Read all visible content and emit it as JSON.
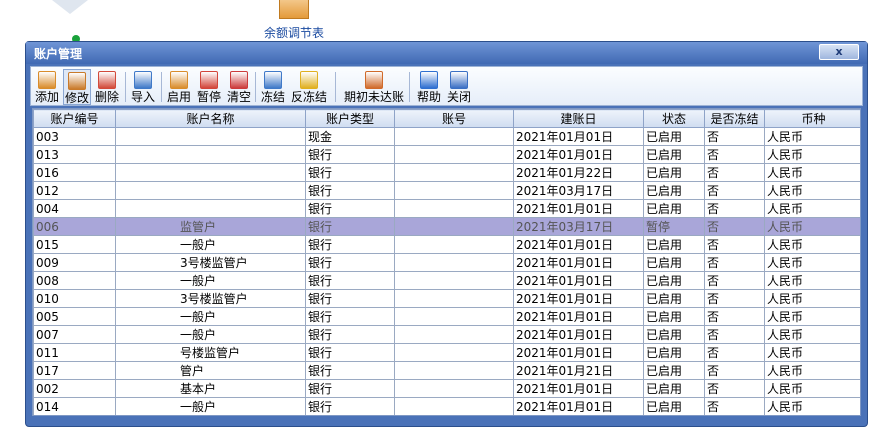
{
  "desktop": {
    "icon_label": "余额调节表"
  },
  "window": {
    "title": "账户管理",
    "close_symbol": "x"
  },
  "toolbar": [
    {
      "label": "添加",
      "icon": "add-icon",
      "color": "#d98c2b"
    },
    {
      "label": "修改",
      "icon": "edit-icon",
      "color": "#c97a2a"
    },
    {
      "label": "删除",
      "icon": "delete-icon",
      "color": "#d24a3a"
    },
    {
      "label": "导入",
      "icon": "import-icon",
      "color": "#3f79c8"
    },
    {
      "label": "启用",
      "icon": "enable-icon",
      "color": "#d98c2b"
    },
    {
      "label": "暂停",
      "icon": "pause-icon",
      "color": "#d2453a"
    },
    {
      "label": "清空",
      "icon": "clear-icon",
      "color": "#cc3b3b"
    },
    {
      "label": "冻结",
      "icon": "freeze-icon",
      "color": "#3f79c8"
    },
    {
      "label": "反冻结",
      "icon": "unfreeze-icon",
      "color": "#e0b020"
    },
    {
      "label": "期初未达账",
      "icon": "opening-icon",
      "color": "#d06a2a"
    },
    {
      "label": "帮助",
      "icon": "help-icon",
      "color": "#2f6fd0"
    },
    {
      "label": "关闭",
      "icon": "close-window-icon",
      "color": "#3a6fc4"
    }
  ],
  "table": {
    "headers": [
      "账户编号",
      "账户名称",
      "账户类型",
      "账号",
      "建账日",
      "状态",
      "是否冻结",
      "币种"
    ],
    "rows": [
      [
        "003",
        "",
        "现金",
        "",
        "2021年01月01日",
        "已启用",
        "否",
        "人民币"
      ],
      [
        "013",
        "",
        "银行",
        "",
        "2021年01月01日",
        "已启用",
        "否",
        "人民币"
      ],
      [
        "016",
        "",
        "银行",
        "",
        "2021年01月22日",
        "已启用",
        "否",
        "人民币"
      ],
      [
        "012",
        "",
        "银行",
        "",
        "2021年03月17日",
        "已启用",
        "否",
        "人民币"
      ],
      [
        "004",
        "",
        "银行",
        "",
        "2021年01月01日",
        "已启用",
        "否",
        "人民币"
      ],
      [
        "006",
        "监管户",
        "银行",
        "",
        "2021年03月17日",
        "暂停",
        "否",
        "人民币"
      ],
      [
        "015",
        "一般户",
        "银行",
        "",
        "2021年01月01日",
        "已启用",
        "否",
        "人民币"
      ],
      [
        "009",
        "3号楼监管户",
        "银行",
        "",
        "2021年01月01日",
        "已启用",
        "否",
        "人民币"
      ],
      [
        "008",
        "一般户",
        "银行",
        "",
        "2021年01月01日",
        "已启用",
        "否",
        "人民币"
      ],
      [
        "010",
        "3号楼监管户",
        "银行",
        "",
        "2021年01月01日",
        "已启用",
        "否",
        "人民币"
      ],
      [
        "005",
        "一般户",
        "银行",
        "",
        "2021年01月01日",
        "已启用",
        "否",
        "人民币"
      ],
      [
        "007",
        "一般户",
        "银行",
        "",
        "2021年01月01日",
        "已启用",
        "否",
        "人民币"
      ],
      [
        "011",
        "号楼监管户",
        "银行",
        "",
        "2021年01月01日",
        "已启用",
        "否",
        "人民币"
      ],
      [
        "017",
        "管户",
        "银行",
        "",
        "2021年01月21日",
        "已启用",
        "否",
        "人民币"
      ],
      [
        "002",
        "基本户",
        "银行",
        "",
        "2021年01月01日",
        "已启用",
        "否",
        "人民币"
      ],
      [
        "014",
        "一般户",
        "银行",
        "",
        "2021年01月01日",
        "已启用",
        "否",
        "人民币"
      ]
    ],
    "selected_row": 5
  }
}
